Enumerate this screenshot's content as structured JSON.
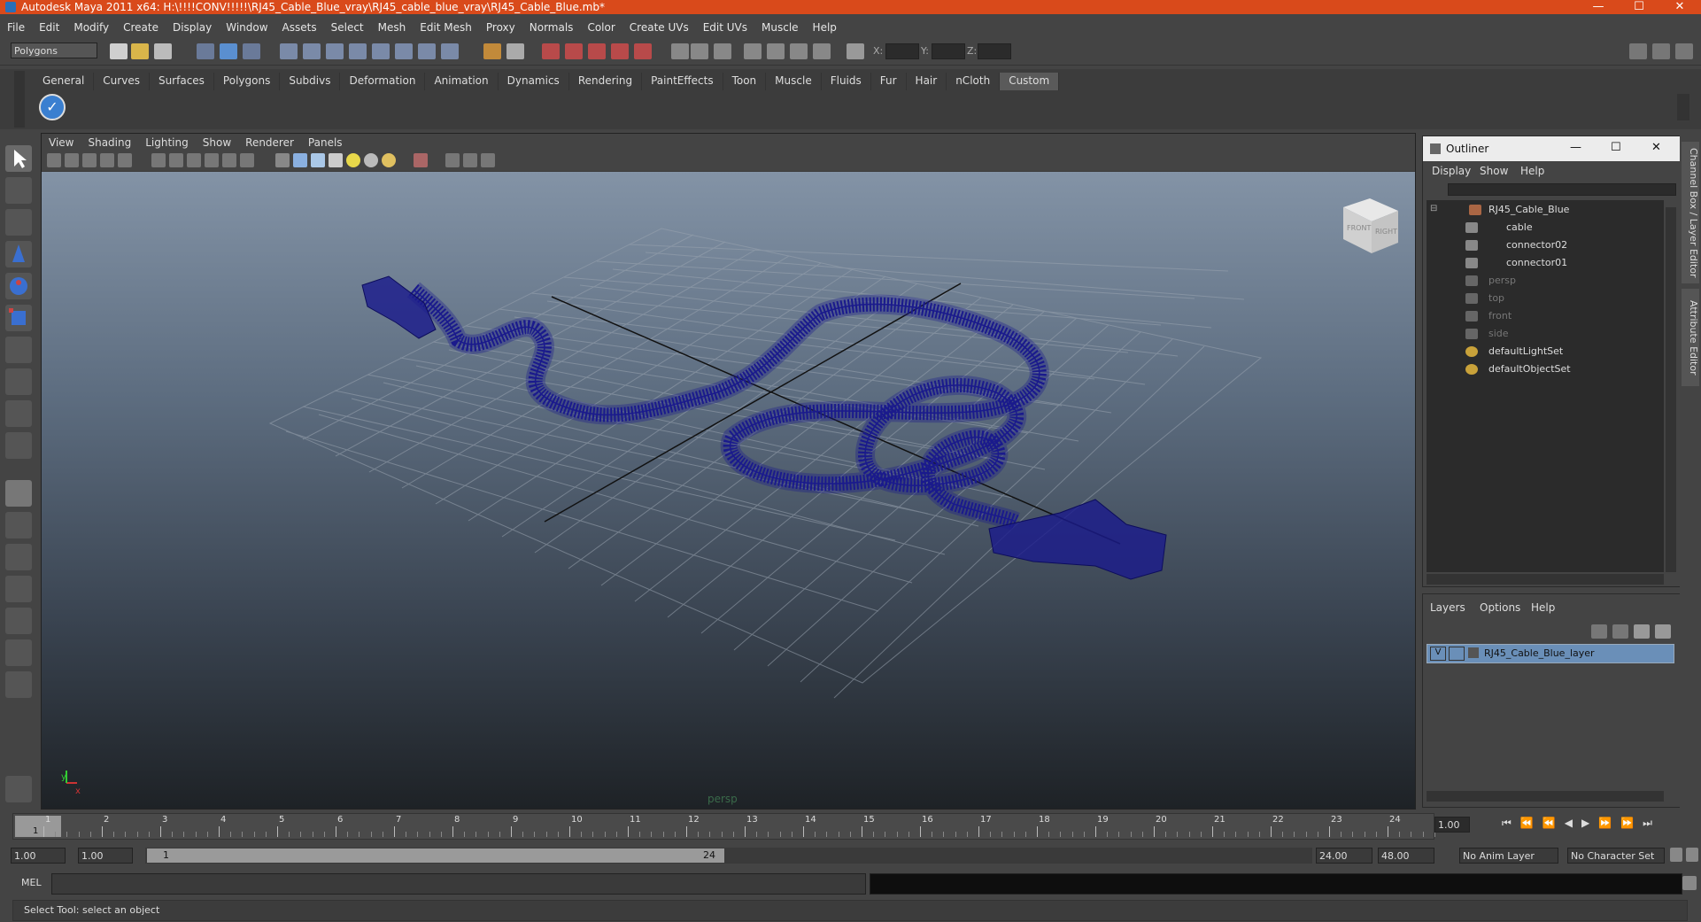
{
  "window": {
    "title": "Autodesk Maya 2011 x64: H:\\!!!!CONV!!!!!\\RJ45_Cable_Blue_vray\\RJ45_cable_blue_vray\\RJ45_Cable_Blue.mb*",
    "minimize": "—",
    "maximize": "☐",
    "close": "✕"
  },
  "menubar": [
    "File",
    "Edit",
    "Modify",
    "Create",
    "Display",
    "Window",
    "Assets",
    "Select",
    "Mesh",
    "Edit Mesh",
    "Proxy",
    "Normals",
    "Color",
    "Create UVs",
    "Edit UVs",
    "Muscle",
    "Help"
  ],
  "statusline": {
    "mode": "Polygons",
    "x_label": "X:",
    "y_label": "Y:",
    "z_label": "Z:"
  },
  "shelf": {
    "tabs": [
      "General",
      "Curves",
      "Surfaces",
      "Polygons",
      "Subdivs",
      "Deformation",
      "Animation",
      "Dynamics",
      "Rendering",
      "PaintEffects",
      "Toon",
      "Muscle",
      "Fluids",
      "Fur",
      "Hair",
      "nCloth",
      "Custom"
    ],
    "active_tab": "Custom"
  },
  "viewport": {
    "menu": [
      "View",
      "Shading",
      "Lighting",
      "Show",
      "Renderer",
      "Panels"
    ],
    "camera_label": "persp",
    "viewcube_front": "FRONT",
    "viewcube_right": "RIGHT",
    "axis_x": "x",
    "axis_y": "y",
    "wire_color": "#1a1a8c",
    "grid_color": "#9aa4b0"
  },
  "outliner": {
    "title": "Outliner",
    "menu": [
      "Display",
      "Show",
      "Help"
    ],
    "items": [
      {
        "label": "RJ45_Cable_Blue",
        "kind": "group",
        "dim": false
      },
      {
        "label": "cable",
        "kind": "mesh",
        "dim": false
      },
      {
        "label": "connector02",
        "kind": "mesh",
        "dim": false
      },
      {
        "label": "connector01",
        "kind": "mesh",
        "dim": false
      },
      {
        "label": "persp",
        "kind": "camera",
        "dim": true
      },
      {
        "label": "top",
        "kind": "camera",
        "dim": true
      },
      {
        "label": "front",
        "kind": "camera",
        "dim": true
      },
      {
        "label": "side",
        "kind": "camera",
        "dim": true
      },
      {
        "label": "defaultLightSet",
        "kind": "set",
        "dim": false
      },
      {
        "label": "defaultObjectSet",
        "kind": "set",
        "dim": false
      }
    ]
  },
  "layers": {
    "menu": [
      "Layers",
      "Options",
      "Help"
    ],
    "visible_flag": "V",
    "layer_name": "RJ45_Cable_Blue_layer",
    "selected_color": "#6a8fb8"
  },
  "sidebar": {
    "tab1": "Channel Box / Layer Editor",
    "tab2": "Attribute Editor"
  },
  "timeline": {
    "ticks": [
      "1",
      "2",
      "3",
      "4",
      "5",
      "6",
      "7",
      "8",
      "9",
      "10",
      "11",
      "12",
      "13",
      "14",
      "15",
      "16",
      "17",
      "18",
      "19",
      "20",
      "21",
      "22",
      "23",
      "24"
    ],
    "current_frame_marker": "1",
    "current_time": "1.00"
  },
  "range": {
    "start": "1.00",
    "start2": "1.00",
    "slider_start": "1",
    "slider_end": "24",
    "end": "24.00",
    "end2": "48.00",
    "anim_layer": "No Anim Layer",
    "character_set": "No Character Set"
  },
  "command": {
    "label": "MEL"
  },
  "help": {
    "text": "Select Tool: select an object"
  }
}
